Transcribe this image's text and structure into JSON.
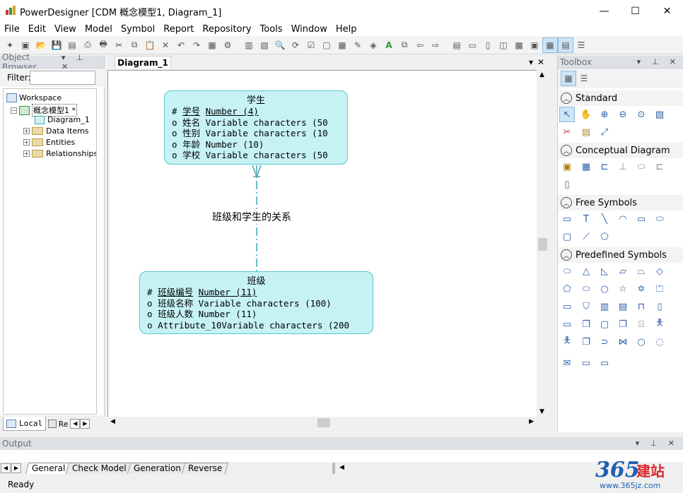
{
  "window": {
    "title": "PowerDesigner [CDM 概念模型1, Diagram_1]",
    "minimize": "—",
    "maximize": "☐",
    "close": "✕"
  },
  "menu": [
    "File",
    "Edit",
    "View",
    "Model",
    "Symbol",
    "Report",
    "Repository",
    "Tools",
    "Window",
    "Help"
  ],
  "object_browser": {
    "title": "Object Browser",
    "filter_label": "Filter:",
    "filter_value": "",
    "tree": {
      "workspace": "Workspace",
      "model": "概念模型1 *",
      "diagram": "Diagram_1",
      "data_items": "Data Items",
      "entities": "Entities",
      "relationships": "Relationships"
    },
    "tabs": {
      "local": "Local",
      "repository": "Re"
    }
  },
  "diagram": {
    "tab_label": "Diagram_1",
    "entities": [
      {
        "name": "学生",
        "attributes": [
          {
            "marker": "#",
            "name": "学号",
            "type": "Number (4)",
            "identifier": true
          },
          {
            "marker": "o",
            "name": "姓名",
            "type": "Variable characters (50",
            "identifier": false
          },
          {
            "marker": "o",
            "name": "性别",
            "type": "Variable characters (10",
            "identifier": false
          },
          {
            "marker": "o",
            "name": "年龄",
            "type": "Number (10)",
            "identifier": false
          },
          {
            "marker": "o",
            "name": "学校",
            "type": "Variable characters (50",
            "identifier": false
          }
        ]
      },
      {
        "name": "班级",
        "attributes": [
          {
            "marker": "#",
            "name": "班级编号",
            "type": "Number (11)",
            "identifier": true
          },
          {
            "marker": "o",
            "name": "班级名称",
            "type": "Variable characters (100)",
            "identifier": false
          },
          {
            "marker": "o",
            "name": "班级人数",
            "type": "Number (11)",
            "identifier": false
          },
          {
            "marker": "o",
            "name": "Attribute_10",
            "type": "Variable characters (200",
            "identifier": false
          }
        ]
      }
    ],
    "relationship_label": "班级和学生的关系"
  },
  "toolbox": {
    "title": "Toolbox",
    "sections": {
      "standard": "Standard",
      "conceptual": "Conceptual Diagram",
      "free": "Free Symbols",
      "predefined": "Predefined Symbols"
    }
  },
  "output": {
    "title": "Output",
    "tabs": [
      "General",
      "Check Model",
      "Generation",
      "Reverse"
    ]
  },
  "status": "Ready",
  "watermark": "365建站 www.365jz.com",
  "colors": {
    "entity_fill": "#c6f2f4",
    "entity_border": "#5ec5cc",
    "relation_line": "#3aa8b2"
  }
}
